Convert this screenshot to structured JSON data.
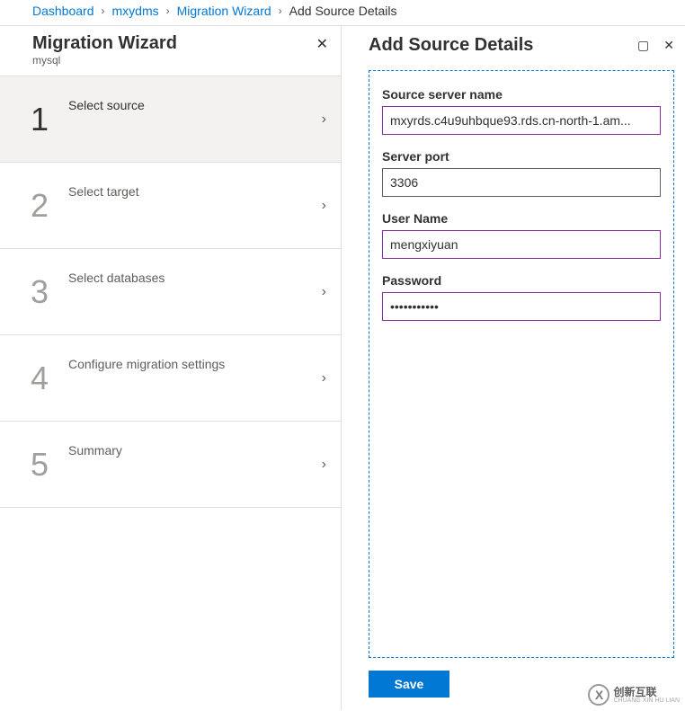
{
  "breadcrumb": {
    "items": [
      "Dashboard",
      "mxydms",
      "Migration Wizard",
      "Add Source Details"
    ]
  },
  "wizard": {
    "title": "Migration Wizard",
    "subtitle": "mysql",
    "steps": [
      {
        "num": "1",
        "label": "Select source",
        "active": true
      },
      {
        "num": "2",
        "label": "Select target",
        "active": false
      },
      {
        "num": "3",
        "label": "Select databases",
        "active": false
      },
      {
        "num": "4",
        "label": "Configure migration settings",
        "active": false
      },
      {
        "num": "5",
        "label": "Summary",
        "active": false
      }
    ]
  },
  "details": {
    "title": "Add Source Details",
    "fields": {
      "server_name": {
        "label": "Source server name",
        "value": "mxyrds.c4u9uhbque93.rds.cn-north-1.am..."
      },
      "port": {
        "label": "Server port",
        "value": "3306"
      },
      "user": {
        "label": "User Name",
        "value": "mengxiyuan"
      },
      "password": {
        "label": "Password",
        "value": "•••••••••••"
      }
    },
    "save_label": "Save"
  },
  "watermark": {
    "brand": "创新互联",
    "sub": "CHUANG XIN HU LIAN"
  }
}
